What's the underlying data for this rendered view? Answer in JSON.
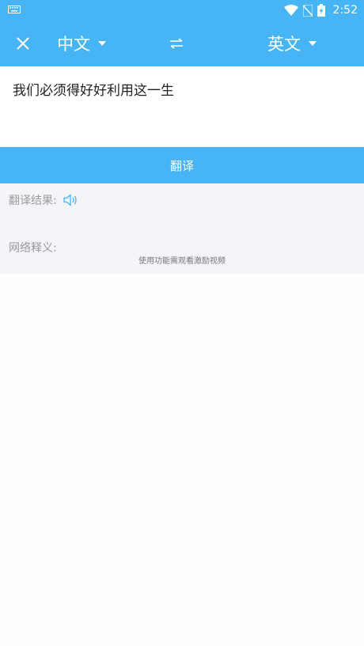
{
  "status_bar": {
    "time": "2:52",
    "icons": [
      "keyboard-icon",
      "wifi-icon",
      "no-sim-icon",
      "battery-charging-icon"
    ]
  },
  "header": {
    "close_icon": "close-icon",
    "source_language": "中文",
    "target_language": "英文",
    "swap_icon": "swap-arrows-icon",
    "color": "#47b5f5"
  },
  "input": {
    "text": "我们必须得好好利用这一生"
  },
  "translate_button": {
    "label": "翻译"
  },
  "result": {
    "translation_label": "翻译结果:",
    "speaker_icon": "speaker-icon",
    "web_definition_label": "网络释义:",
    "hint": "使用功能需观看激励视频"
  }
}
